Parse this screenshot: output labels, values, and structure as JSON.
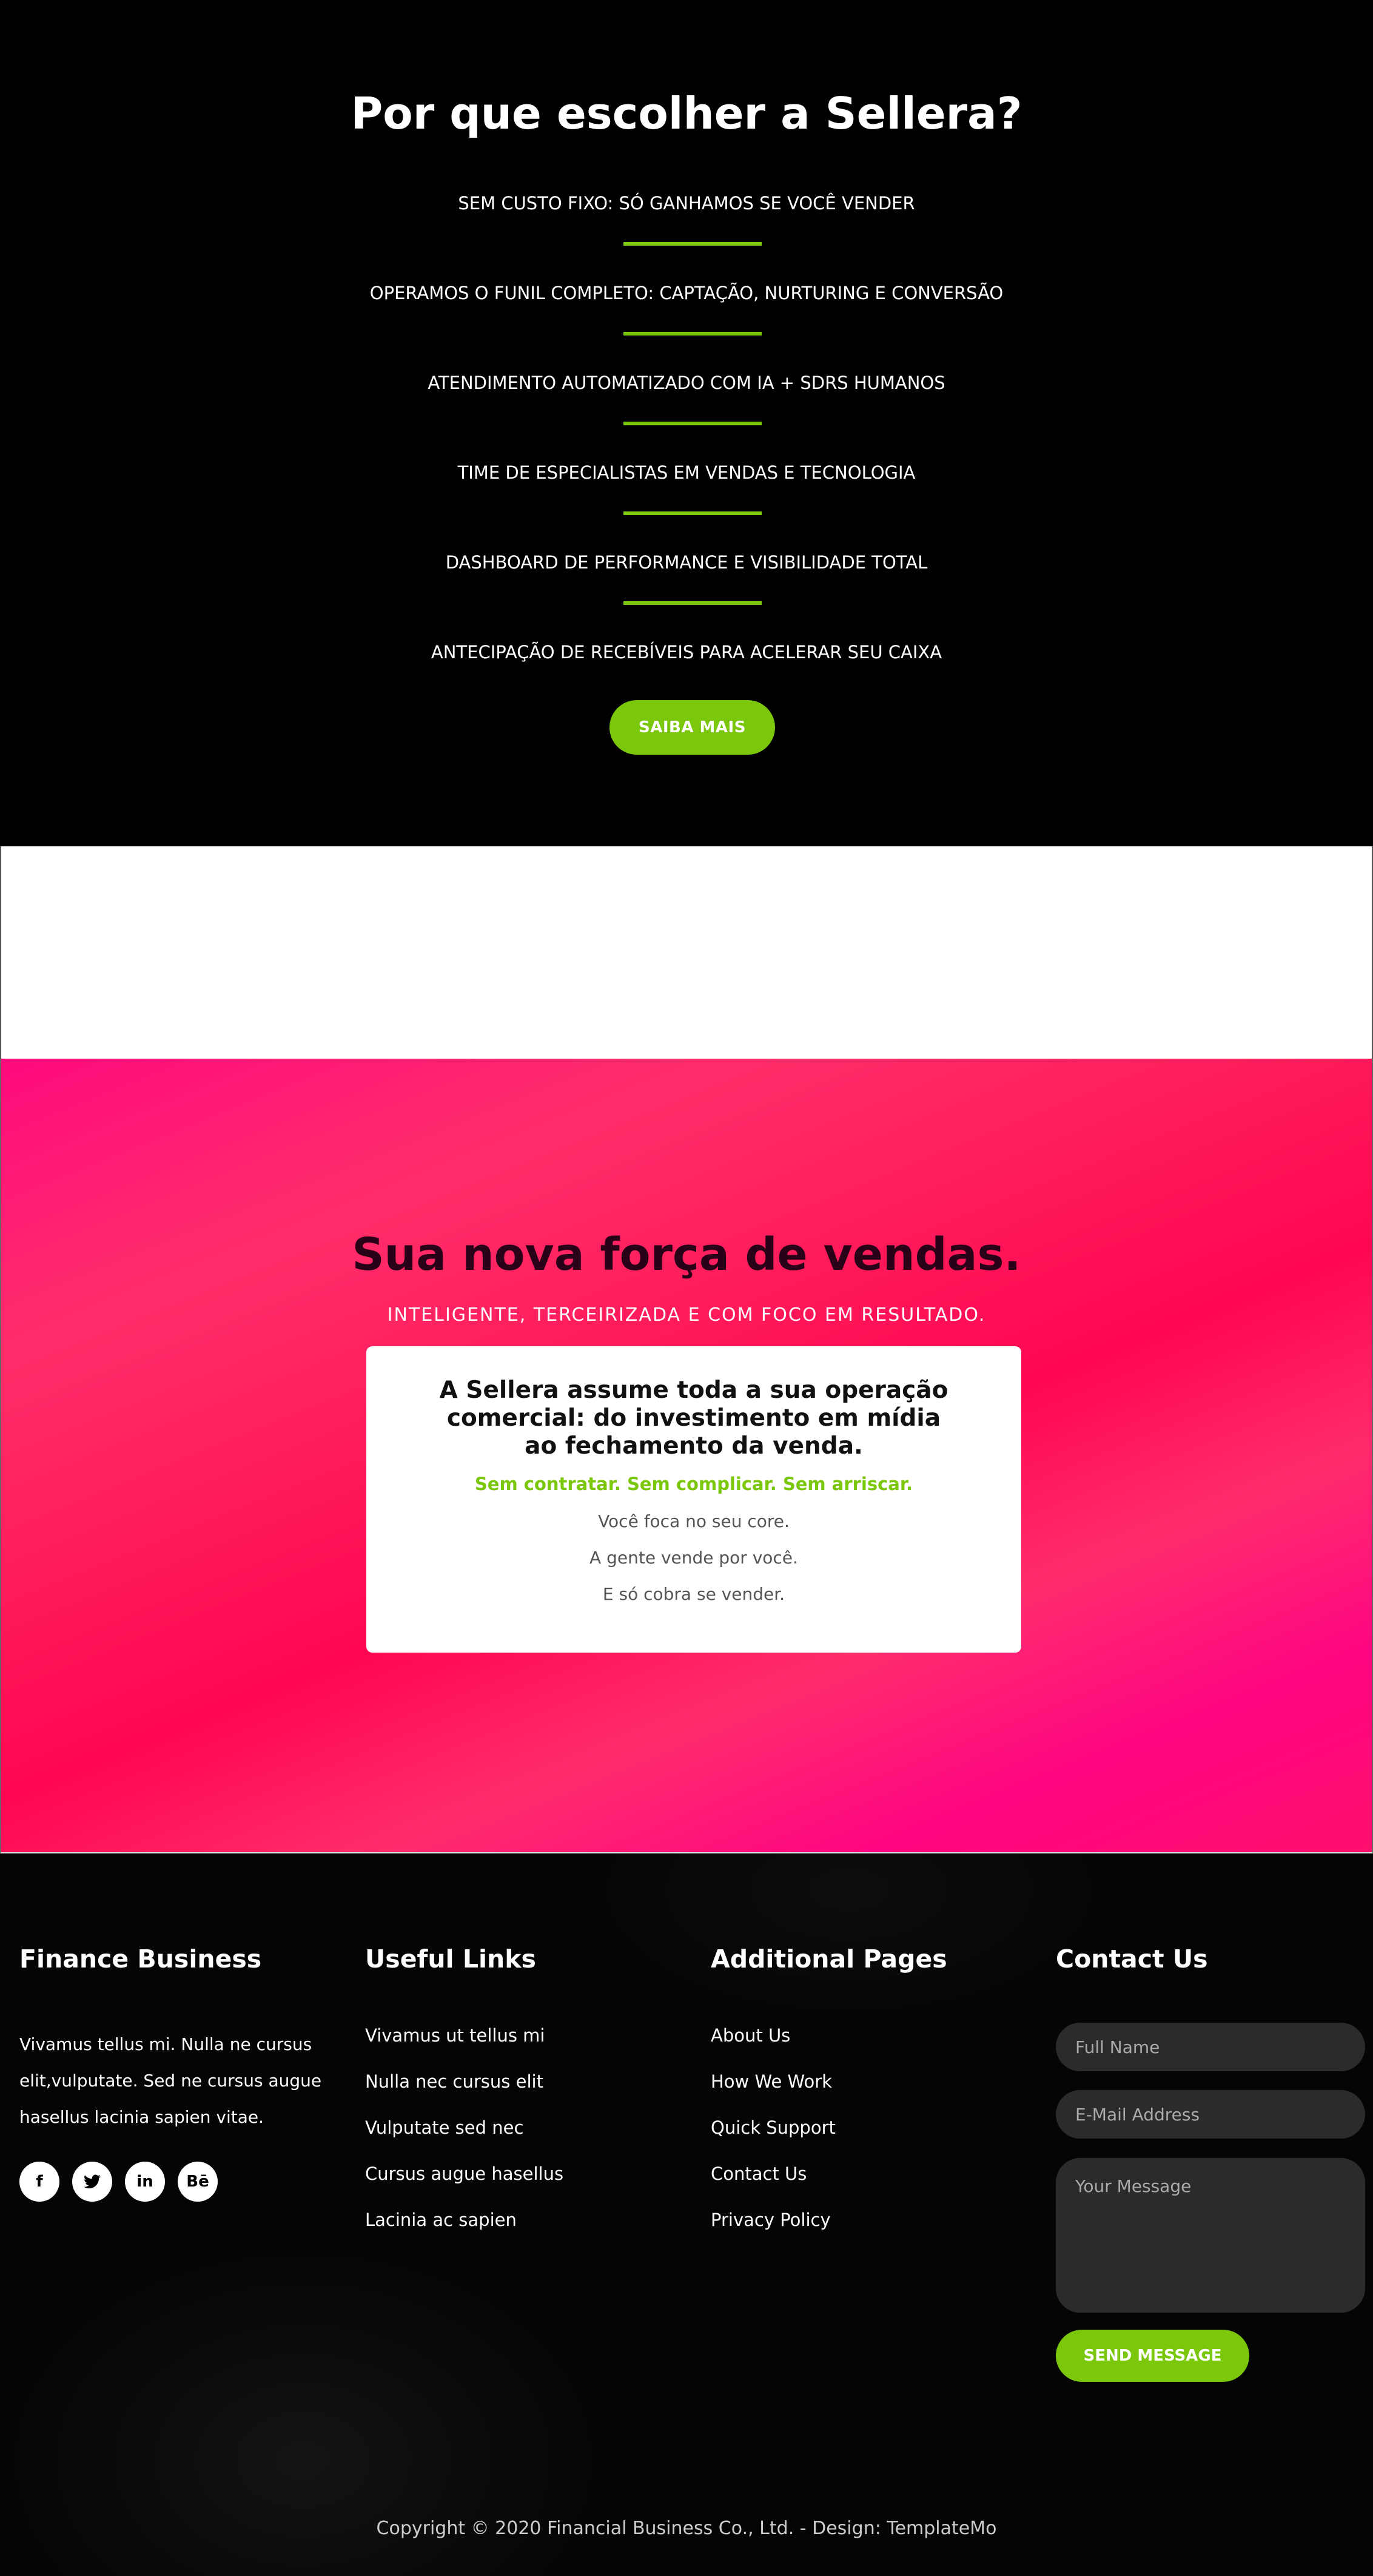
{
  "why": {
    "title": "Por que escolher a Sellera?",
    "items": [
      "SEM CUSTO FIXO: SÓ GANHAMOS SE VOCÊ VENDER",
      "OPERAMOS O FUNIL COMPLETO: CAPTAÇÃO, NURTURING E CONVERSÃO",
      "ATENDIMENTO AUTOMATIZADO COM IA + SDRS HUMANOS",
      "TIME DE ESPECIALISTAS EM VENDAS E TECNOLOGIA",
      "DASHBOARD DE PERFORMANCE E VISIBILIDADE TOTAL",
      "ANTECIPAÇÃO DE RECEBÍVEIS PARA ACELERAR SEU CAIXA"
    ],
    "cta_label": "SAIBA MAIS"
  },
  "hero": {
    "headline": "Sua nova força de vendas.",
    "subline": "INTELIGENTE, TERCEIRIZADA E COM FOCO EM RESULTADO.",
    "card": {
      "title": "A Sellera assume toda a sua operação comercial: do investimento em mídia ao fechamento da venda.",
      "accent": "Sem contratar. Sem complicar. Sem arriscar.",
      "lines": [
        "Você foca no seu core.",
        "A gente vende por você.",
        "E só cobra se vender."
      ]
    }
  },
  "footer": {
    "about": {
      "title": "Finance Business",
      "text": "Vivamus tellus mi. Nulla ne cursus elit,vulputate. Sed ne cursus augue hasellus lacinia sapien vitae.",
      "social": [
        "f",
        "t",
        "in",
        "Bē"
      ]
    },
    "useful": {
      "title": "Useful Links",
      "links": [
        "Vivamus ut tellus mi",
        "Nulla nec cursus elit",
        "Vulputate sed nec",
        "Cursus augue hasellus",
        "Lacinia ac sapien"
      ]
    },
    "pages": {
      "title": "Additional Pages",
      "links": [
        "About Us",
        "How We Work",
        "Quick Support",
        "Contact Us",
        "Privacy Policy"
      ]
    },
    "contact": {
      "title": "Contact Us",
      "name_placeholder": "Full Name",
      "email_placeholder": "E-Mail Address",
      "message_placeholder": "Your Message",
      "send_label": "SEND MESSAGE"
    },
    "copyright": "Copyright © 2020 Financial Business Co., Ltd. - Design: TemplateMo"
  },
  "colors": {
    "accent_green": "#7ac70c",
    "hero_pink": "#ff1a5a",
    "background_black": "#000000"
  }
}
